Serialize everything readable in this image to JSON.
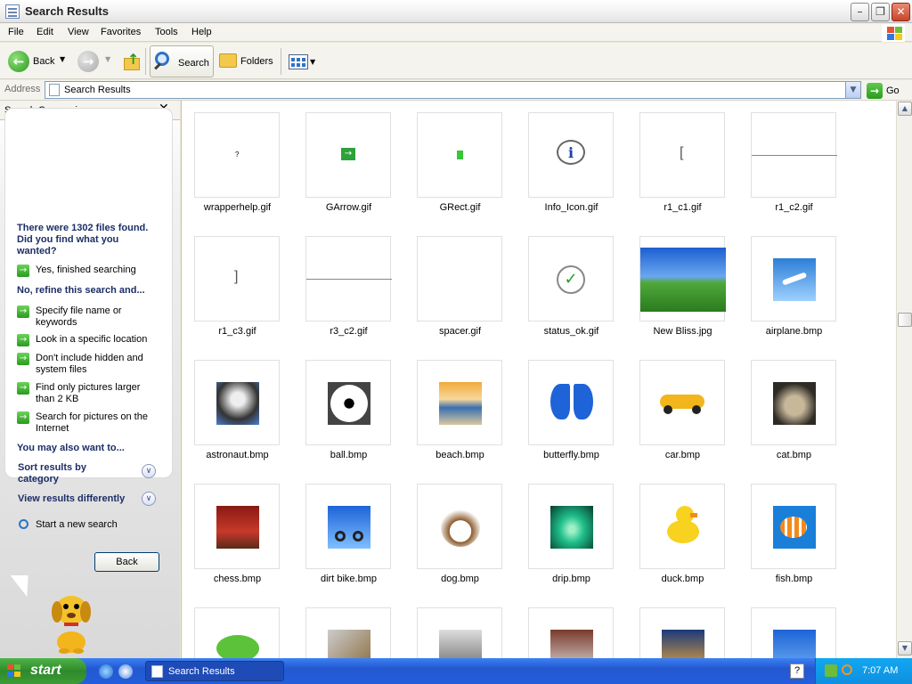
{
  "window": {
    "title": "Search Results"
  },
  "menu": [
    "File",
    "Edit",
    "View",
    "Favorites",
    "Tools",
    "Help"
  ],
  "toolbar": {
    "back": "Back",
    "search": "Search",
    "folders": "Folders"
  },
  "address": {
    "label": "Address",
    "value": "Search Results",
    "go": "Go"
  },
  "companion": {
    "title": "Search Companion",
    "found_message": "There were 1302 files found. Did you find what you wanted?",
    "yes_finished": "Yes, finished searching",
    "refine_heading": "No, refine this search and...",
    "refine_options": [
      "Specify file name or keywords",
      "Look in a specific location",
      "Don't include hidden and system files",
      "Find only pictures larger than 2 KB",
      "Search for pictures on the Internet"
    ],
    "also_heading": "You may also want to...",
    "sort_results": "Sort results by category",
    "view_results": "View results differently",
    "new_search": "Start a new search",
    "back_button": "Back"
  },
  "files": [
    {
      "name": "wrapperhelp.gif",
      "icon": "question-glyph-icon"
    },
    {
      "name": "GArrow.gif",
      "icon": "green-arrow-icon"
    },
    {
      "name": "GRect.gif",
      "icon": "green-rect-icon"
    },
    {
      "name": "Info_Icon.gif",
      "icon": "info-balloon-icon"
    },
    {
      "name": "r1_c1.gif",
      "icon": "bracket-left-icon"
    },
    {
      "name": "r1_c2.gif",
      "icon": "line-icon"
    },
    {
      "name": "r1_c3.gif",
      "icon": "bracket-right-icon"
    },
    {
      "name": "r3_c2.gif",
      "icon": "line-icon"
    },
    {
      "name": "spacer.gif",
      "icon": "blank-icon"
    },
    {
      "name": "status_ok.gif",
      "icon": "checkmark-icon"
    },
    {
      "name": "New Bliss.jpg",
      "icon": "bliss-landscape-icon"
    },
    {
      "name": "airplane.bmp",
      "icon": "airplane-icon"
    },
    {
      "name": "astronaut.bmp",
      "icon": "astronaut-icon"
    },
    {
      "name": "ball.bmp",
      "icon": "soccer-ball-icon"
    },
    {
      "name": "beach.bmp",
      "icon": "beach-icon"
    },
    {
      "name": "butterfly.bmp",
      "icon": "butterfly-icon"
    },
    {
      "name": "car.bmp",
      "icon": "car-icon"
    },
    {
      "name": "cat.bmp",
      "icon": "cat-icon"
    },
    {
      "name": "chess.bmp",
      "icon": "chess-icon"
    },
    {
      "name": "dirt bike.bmp",
      "icon": "dirt-bike-icon"
    },
    {
      "name": "dog.bmp",
      "icon": "dog-icon"
    },
    {
      "name": "drip.bmp",
      "icon": "drip-icon"
    },
    {
      "name": "duck.bmp",
      "icon": "duck-icon"
    },
    {
      "name": "fish.bmp",
      "icon": "fish-icon"
    }
  ],
  "partial_row_icons": [
    "frog-icon",
    "guitar-icon",
    "horse-icon",
    "karate-icon",
    "rocket-icon",
    "palm-tree-icon"
  ],
  "taskbar": {
    "start": "start",
    "task": "Search Results",
    "clock": "7:07 AM"
  },
  "colors": {
    "accent": "#245edc",
    "start_green": "#3c9b37",
    "go_green": "#2a9b1e",
    "link_blue": "#1c2e66"
  }
}
